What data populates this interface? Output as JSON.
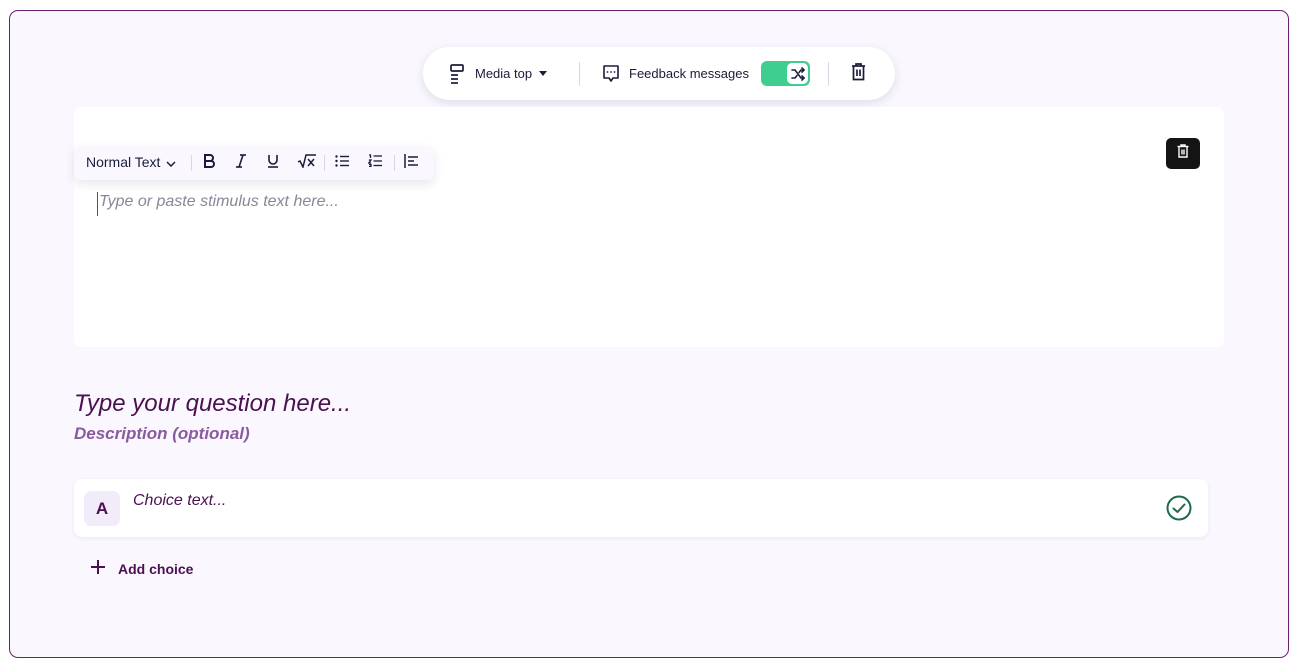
{
  "toolbar": {
    "layout_label": "Media top",
    "feedback_label": "Feedback messages",
    "shuffle_toggle_on": true
  },
  "stimulus": {
    "text_style": "Normal Text",
    "placeholder": "Type or paste stimulus text here..."
  },
  "question": {
    "title_placeholder": "Type your question here...",
    "description_placeholder": "Description (optional)"
  },
  "choices": [
    {
      "letter": "A",
      "placeholder": "Choice text..."
    }
  ],
  "add_choice_label": "Add choice",
  "colors": {
    "frame_border": "#6b1f70",
    "accent_text": "#4a1050",
    "toggle_on": "#3ecf8e",
    "check_green": "#1c6b4a"
  }
}
